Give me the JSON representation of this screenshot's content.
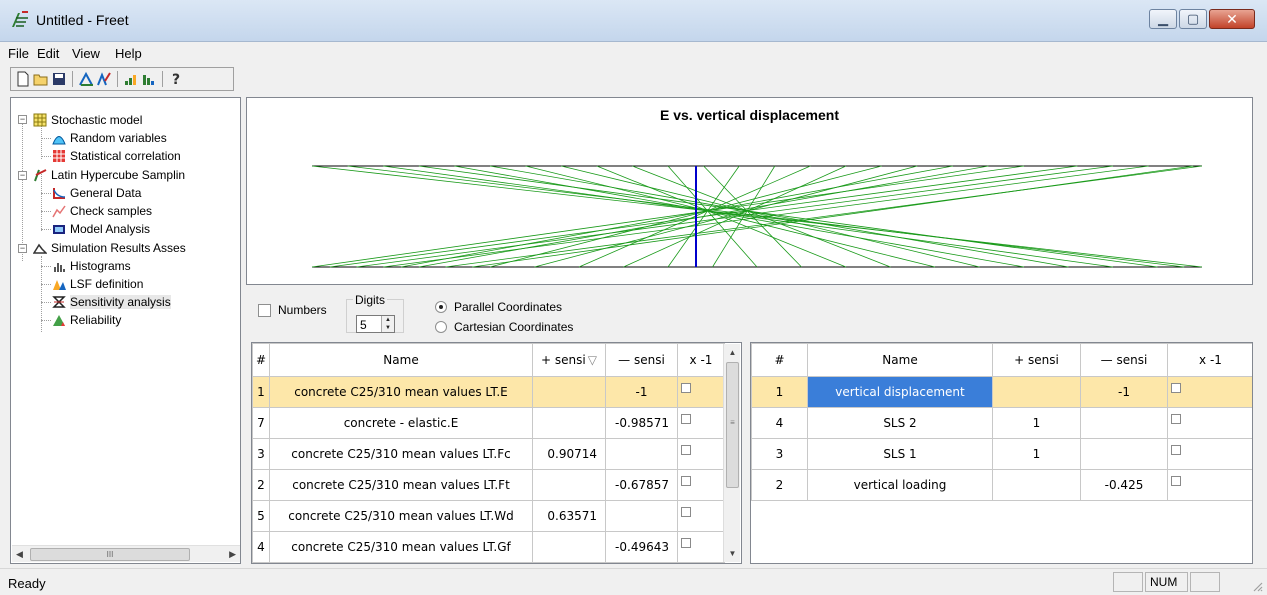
{
  "window": {
    "title": "Untitled - Freet"
  },
  "menu": [
    "File",
    "Edit",
    "View",
    "Help"
  ],
  "toolbar": {
    "buttons": [
      "new-icon",
      "open-icon",
      "save-icon",
      "sampling-icon",
      "histogram-icon",
      "export-icon",
      "import-icon",
      "help-icon"
    ]
  },
  "tree": {
    "items": [
      {
        "label": "Stochastic model",
        "icon": "grid-icon"
      },
      {
        "label": "Random variables",
        "icon": "distribution-icon"
      },
      {
        "label": "Statistical correlation",
        "icon": "correlation-icon"
      },
      {
        "label": "Latin Hypercube Samplin",
        "icon": "lhs-icon"
      },
      {
        "label": "General Data",
        "icon": "general-data-icon"
      },
      {
        "label": "Check samples",
        "icon": "check-samples-icon"
      },
      {
        "label": "Model Analysis",
        "icon": "model-analysis-icon"
      },
      {
        "label": "Simulation Results Asses",
        "icon": "results-icon"
      },
      {
        "label": "Histograms",
        "icon": "histogram-icon"
      },
      {
        "label": "LSF definition",
        "icon": "lsf-icon"
      },
      {
        "label": "Sensitivity analysis",
        "icon": "sensitivity-icon"
      },
      {
        "label": "Reliability",
        "icon": "reliability-icon"
      }
    ],
    "selected": "Sensitivity analysis"
  },
  "chart": {
    "title": "E vs. vertical displacement",
    "colors": {
      "lines": "#1a9a1a",
      "marker": "#0000cc",
      "axes": "#000000"
    }
  },
  "chart_data": {
    "type": "parallel-coordinates",
    "title": "E vs. vertical displacement",
    "axes": [
      "E",
      "vertical displacement"
    ],
    "pairs": [
      [
        0.0,
        1.0
      ],
      [
        0.08,
        0.9
      ],
      [
        0.16,
        0.8
      ],
      [
        0.24,
        0.7
      ],
      [
        0.32,
        0.6
      ],
      [
        0.4,
        0.5
      ],
      [
        0.48,
        0.4
      ],
      [
        0.56,
        0.3
      ],
      [
        0.64,
        0.2
      ],
      [
        0.72,
        0.1
      ],
      [
        0.8,
        0.0
      ],
      [
        0.9,
        0.05
      ],
      [
        1.0,
        0.15
      ],
      [
        0.12,
        0.95
      ],
      [
        0.2,
        0.85
      ],
      [
        0.28,
        0.75
      ],
      [
        0.36,
        0.65
      ],
      [
        0.44,
        0.55
      ],
      [
        0.52,
        0.45
      ],
      [
        0.6,
        0.35
      ],
      [
        0.68,
        0.25
      ],
      [
        0.76,
        0.12
      ],
      [
        0.86,
        0.02
      ],
      [
        0.94,
        0.08
      ],
      [
        0.04,
        0.98
      ],
      [
        0.99,
        0.18
      ]
    ]
  },
  "controls": {
    "numbers_label": "Numbers",
    "digits_label": "Digits",
    "digits_value": "5",
    "radio_parallel": "Parallel Coordinates",
    "radio_cartesian": "Cartesian Coordinates",
    "selected_mode": "parallel"
  },
  "left_table": {
    "headers": [
      "#",
      "Name",
      "+ sensi",
      "— sensi",
      "x -1"
    ],
    "rows": [
      {
        "num": "1",
        "name": "concrete C25/310 mean values LT.E",
        "pos": "",
        "neg": "-1"
      },
      {
        "num": "7",
        "name": "concrete - elastic.E",
        "pos": "",
        "neg": "-0.98571"
      },
      {
        "num": "3",
        "name": "concrete C25/310 mean values LT.Fc",
        "pos": "0.90714",
        "neg": ""
      },
      {
        "num": "2",
        "name": "concrete C25/310 mean values LT.Ft",
        "pos": "",
        "neg": "-0.67857"
      },
      {
        "num": "5",
        "name": "concrete C25/310 mean values LT.Wd",
        "pos": "0.63571",
        "neg": ""
      },
      {
        "num": "4",
        "name": "concrete C25/310 mean values LT.Gf",
        "pos": "",
        "neg": "-0.49643"
      }
    ]
  },
  "right_table": {
    "headers": [
      "#",
      "Name",
      "+ sensi",
      "— sensi",
      "x -1"
    ],
    "rows": [
      {
        "num": "1",
        "name": "vertical displacement",
        "pos": "",
        "neg": "-1"
      },
      {
        "num": "4",
        "name": "SLS 2",
        "pos": "1",
        "neg": ""
      },
      {
        "num": "3",
        "name": "SLS 1",
        "pos": "1",
        "neg": ""
      },
      {
        "num": "2",
        "name": "vertical loading",
        "pos": "",
        "neg": "-0.425"
      }
    ]
  },
  "status": {
    "text": "Ready",
    "num": "NUM"
  }
}
